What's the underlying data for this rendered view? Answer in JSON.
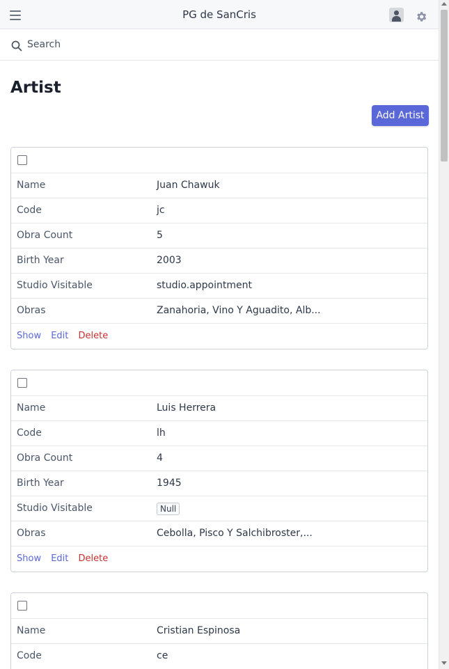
{
  "header": {
    "title": "PG de SanCris"
  },
  "search": {
    "placeholder": "Search"
  },
  "page": {
    "title": "Artist",
    "add_button_label": "Add Artist"
  },
  "labels": {
    "name": "Name",
    "code": "Code",
    "obra_count": "Obra Count",
    "birth_year": "Birth Year",
    "studio_visitable": "Studio Visitable",
    "obras": "Obras"
  },
  "actions": {
    "show": "Show",
    "edit": "Edit",
    "delete": "Delete"
  },
  "artists": [
    {
      "name": "Juan Chawuk",
      "code": "jc",
      "obra_count": "5",
      "birth_year": "2003",
      "studio_visitable": "studio.appointment",
      "obras": "Zanahoria, Vino Y Aguadito, Alb..."
    },
    {
      "name": "Luis Herrera",
      "code": "lh",
      "obra_count": "4",
      "birth_year": "1945",
      "studio_visitable": "Null",
      "obras": "Cebolla, Pisco Y Salchibroster,..."
    },
    {
      "name": "Cristian Espinosa",
      "code": "ce"
    }
  ],
  "colors": {
    "accent": "#5a67d8",
    "danger": "#c53030"
  },
  "icons": [
    "menu-icon",
    "user-icon",
    "gear-icon",
    "search-icon"
  ]
}
